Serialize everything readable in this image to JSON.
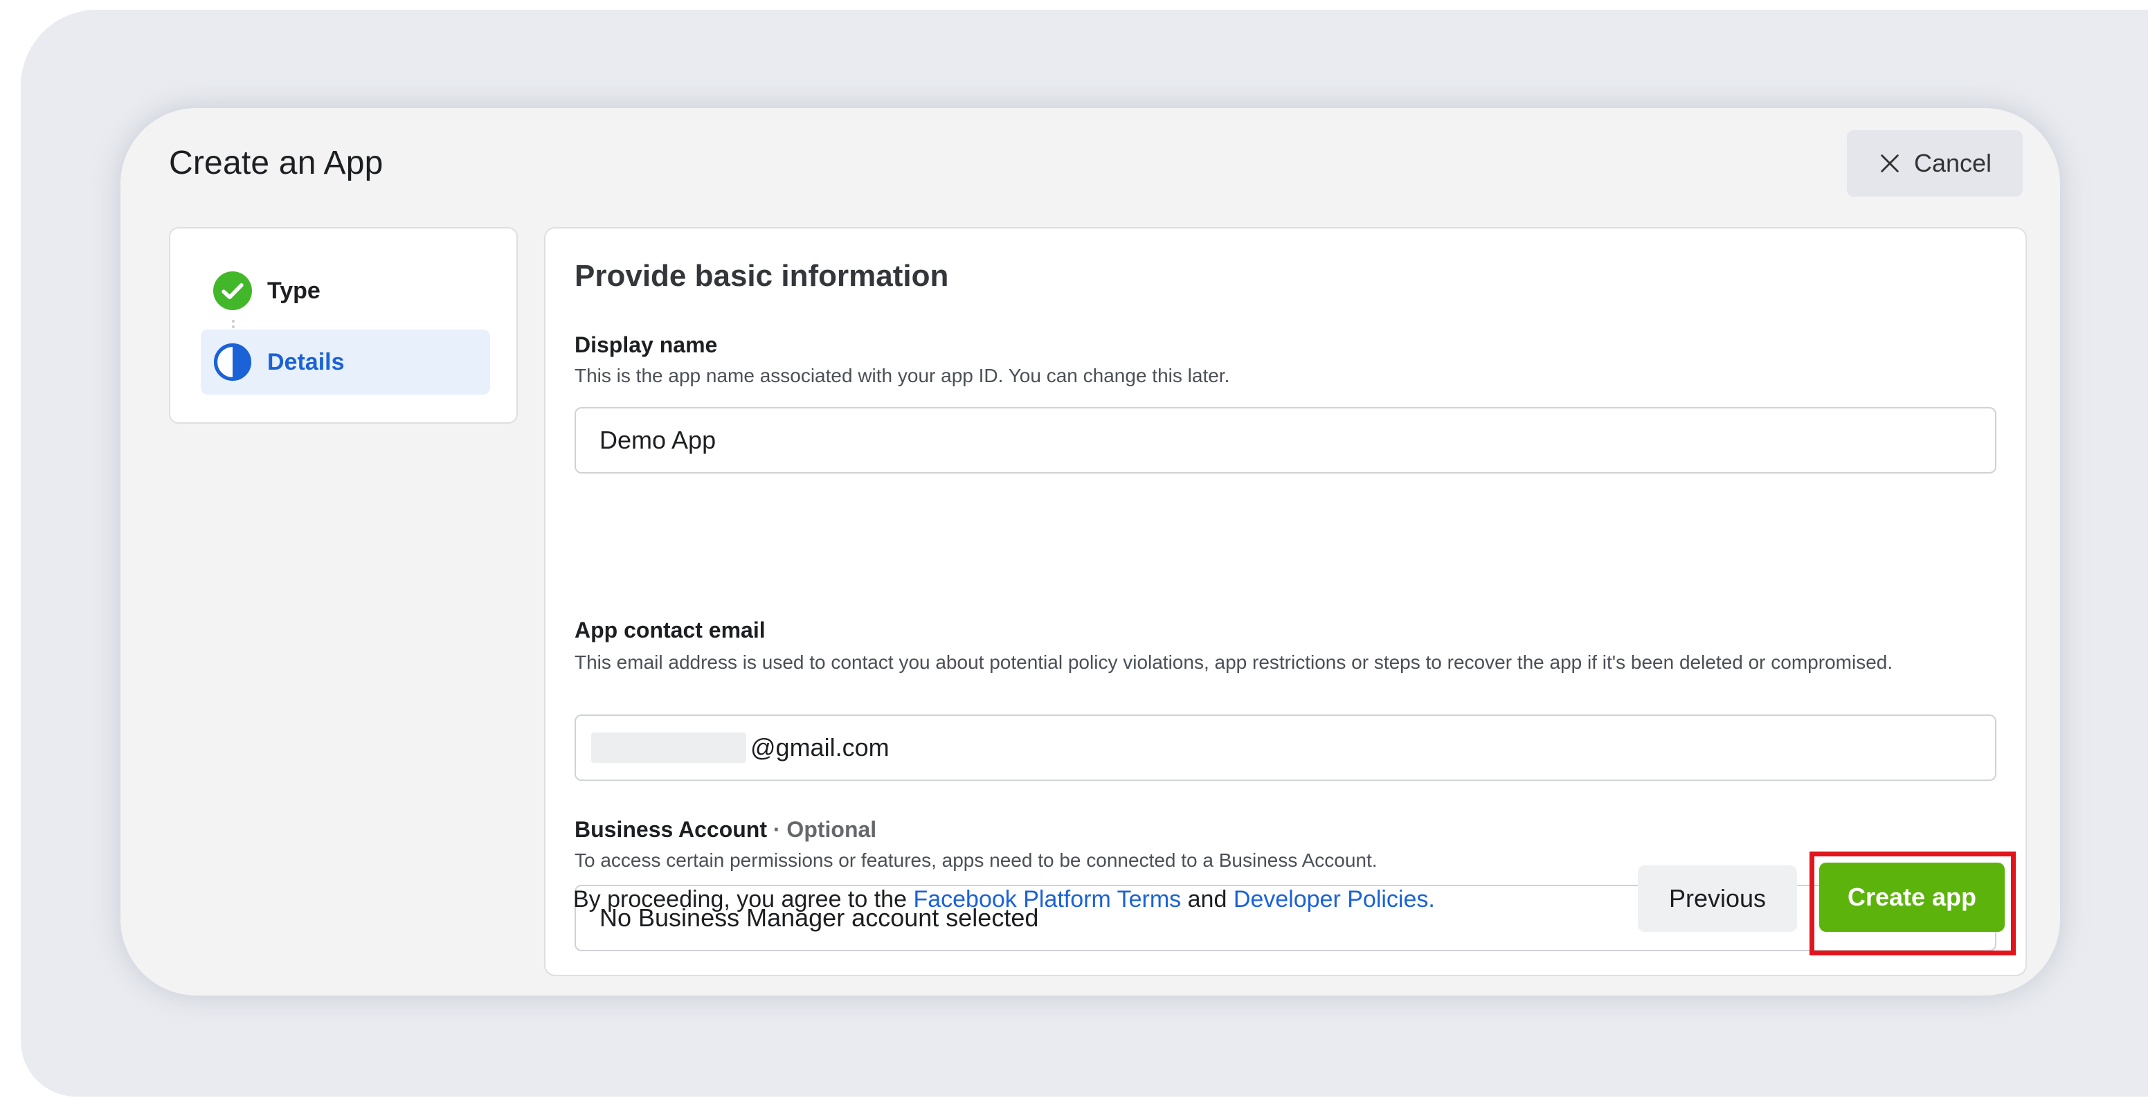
{
  "dialog": {
    "title": "Create an App",
    "cancel_label": "Cancel"
  },
  "steps": [
    {
      "label": "Type",
      "state": "complete"
    },
    {
      "label": "Details",
      "state": "current"
    }
  ],
  "form": {
    "heading": "Provide basic information",
    "display_name": {
      "label": "Display name",
      "help": "This is the app name associated with your app ID. You can change this later.",
      "value": "Demo App"
    },
    "contact_email": {
      "label": "App contact email",
      "help": "This email address is used to contact you about potential policy violations, app restrictions or steps to recover the app if it's been deleted or compromised.",
      "value": "@gmail.com"
    },
    "business_account": {
      "label": "Business Account",
      "optional": " · Optional",
      "help": "To access certain permissions or features, apps need to be connected to a Business Account.",
      "selected": "No Business Manager account selected"
    },
    "terms": {
      "prefix": "By proceeding, you agree to the ",
      "link1": "Facebook Platform Terms",
      "middle": " and ",
      "link2": "Developer Policies."
    },
    "previous_label": "Previous",
    "create_label": "Create app"
  },
  "colors": {
    "primary_link": "#1a62d6",
    "create_button": "#5cb30c",
    "highlight": "#e3141b",
    "step_complete": "#42b72a"
  },
  "icons": {
    "cancel": "close-icon",
    "type_step": "check-circle-icon",
    "details_step": "half-circle-icon",
    "dropdown": "caret-down-icon"
  }
}
